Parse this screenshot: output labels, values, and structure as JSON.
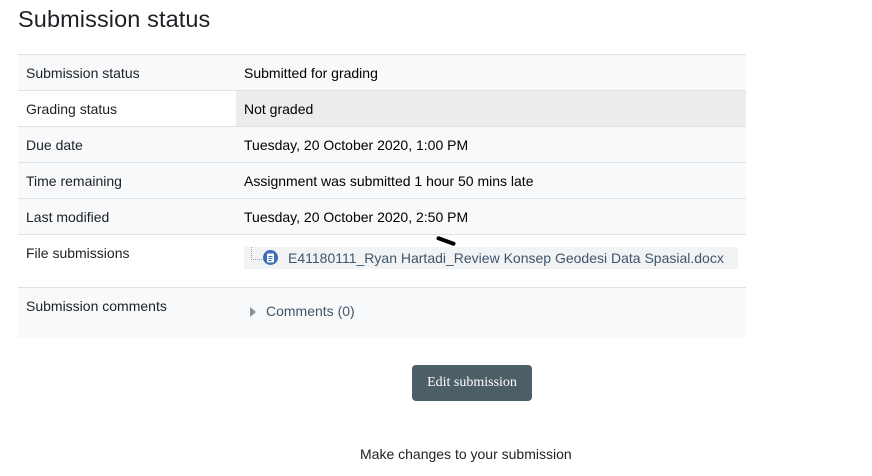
{
  "page_title": "Submission status",
  "rows": {
    "submission_status": {
      "label": "Submission status",
      "value": "Submitted for grading"
    },
    "grading_status": {
      "label": "Grading status",
      "value": "Not graded"
    },
    "due_date": {
      "label": "Due date",
      "value": "Tuesday, 20 October 2020, 1:00 PM"
    },
    "time_remaining": {
      "label": "Time remaining",
      "value": "Assignment was submitted 1 hour 50 mins late"
    },
    "last_modified": {
      "label": "Last modified",
      "value": "Tuesday, 20 October 2020, 2:50 PM"
    },
    "file_submissions": {
      "label": "File submissions",
      "file_name": "E41180111_Ryan Hartadi_Review Konsep Geodesi Data Spasial.docx",
      "icon": "document-icon"
    },
    "submission_comments": {
      "label": "Submission comments",
      "toggle_label": "Comments (0)",
      "icon": "caret-right-icon"
    }
  },
  "actions": {
    "edit_label": "Edit submission",
    "edit_help": "Make changes to your submission"
  },
  "colors": {
    "button_bg": "#4d5f66",
    "link": "#40566b",
    "file_icon": "#3b6eb7",
    "grading_cell_bg": "#ececec"
  }
}
